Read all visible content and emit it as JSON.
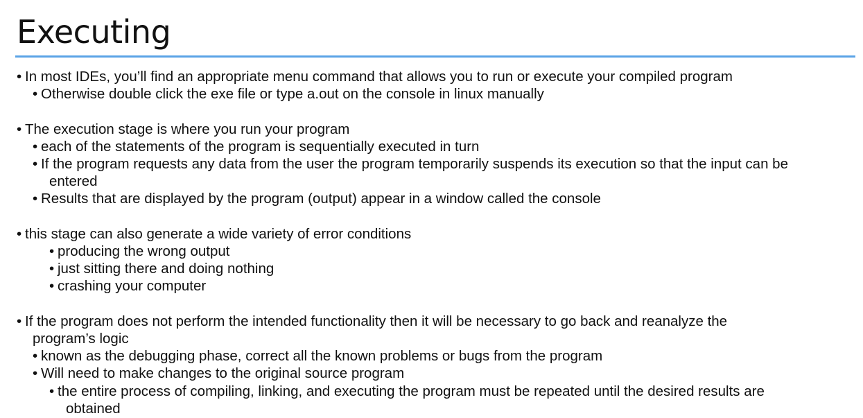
{
  "slide": {
    "title": "Executing",
    "accent_color": "#5aa3e6",
    "bullet_glyph": "•"
  },
  "bullets": [
    "In most IDEs, you’ll find an appropriate menu command that allows you to run or execute your compiled program",
    "Otherwise double click the exe file or type a.out on the console in linux manually",
    "The execution stage is where you run your program",
    "each of the statements of the program is sequentially executed in turn",
    "If the program requests any data from the user the program temporarily suspends its execution so that the input can be",
    "entered",
    "Results that are displayed by the program (output) appear in a window called the console",
    "this stage can also generate a wide variety of error conditions",
    "producing the wrong output",
    "just sitting there and doing nothing",
    "crashing your computer",
    "If the program does not perform the intended functionality then it will be necessary to go back and reanalyze the",
    "program’s logic",
    "known as the debugging phase, correct all the known problems or bugs from the program",
    "Will need to make changes to the original source program",
    "the entire process of compiling, linking, and executing the program must be repeated until the desired results are",
    "obtained"
  ]
}
